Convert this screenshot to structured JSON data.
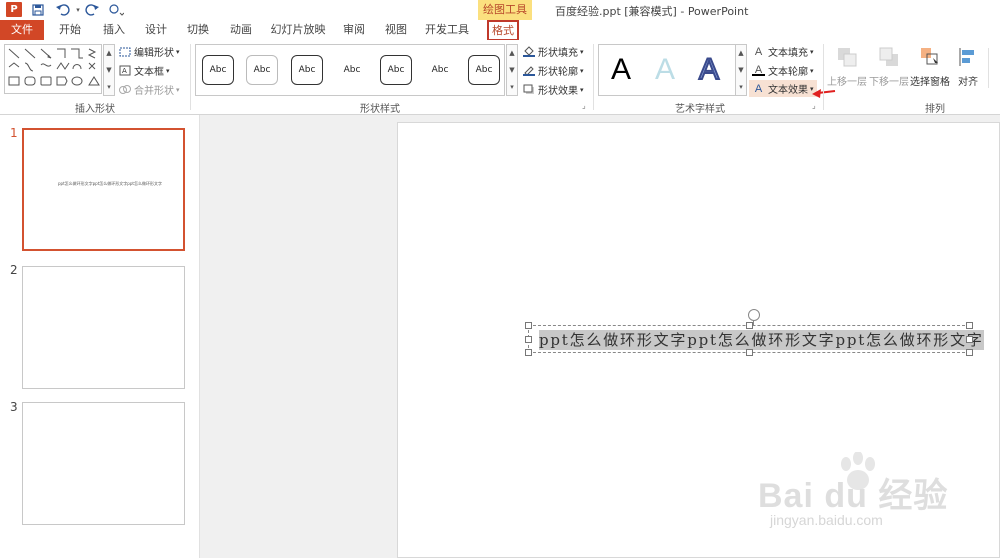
{
  "window": {
    "title": "百度经验.ppt [兼容模式] - PowerPoint",
    "contextual_tab_group": "绘图工具"
  },
  "quick_access": {
    "logo": "P",
    "icons": [
      "save-icon",
      "undo-icon",
      "redo-icon",
      "customize-icon"
    ]
  },
  "tabs": [
    {
      "label": "文件"
    },
    {
      "label": "开始"
    },
    {
      "label": "插入"
    },
    {
      "label": "设计"
    },
    {
      "label": "切换"
    },
    {
      "label": "动画"
    },
    {
      "label": "幻灯片放映"
    },
    {
      "label": "审阅"
    },
    {
      "label": "视图"
    },
    {
      "label": "开发工具"
    },
    {
      "label": "格式"
    }
  ],
  "ribbon": {
    "insert_shapes": {
      "label": "插入形状",
      "edit_shape": "编辑形状",
      "text_box": "文本框",
      "merge_shapes": "合并形状"
    },
    "shape_styles": {
      "label": "形状样式",
      "swatch_text": "Abc",
      "fill": "形状填充",
      "outline": "形状轮廓",
      "effects": "形状效果"
    },
    "wordart_styles": {
      "label": "艺术字样式",
      "sample": "A",
      "text_fill": "文本填充",
      "text_outline": "文本轮廓",
      "text_effects": "文本效果"
    },
    "arrange": {
      "label": "排列",
      "bring_forward": "上移一层",
      "send_backward": "下移一层",
      "selection_pane": "选择窗格",
      "align": "对齐"
    }
  },
  "slides": [
    {
      "number": "1",
      "thumb_text": "ppt怎么做环形文字ppt怎么做环形文字ppt怎么做环形文字",
      "active": true
    },
    {
      "number": "2",
      "thumb_text": "",
      "active": false
    },
    {
      "number": "3",
      "thumb_text": "",
      "active": false
    }
  ],
  "slide_text": "ppt怎么做环形文字ppt怎么做环形文字ppt怎么做环形文字",
  "watermark": {
    "brand": "Bai du 经验",
    "url": "jingyan.baidu.com"
  },
  "colors": {
    "accent": "#d24726",
    "contextual": "#fbe07f",
    "highlight_box": "#c0392b",
    "annotation_arrow": "#e0201f"
  }
}
